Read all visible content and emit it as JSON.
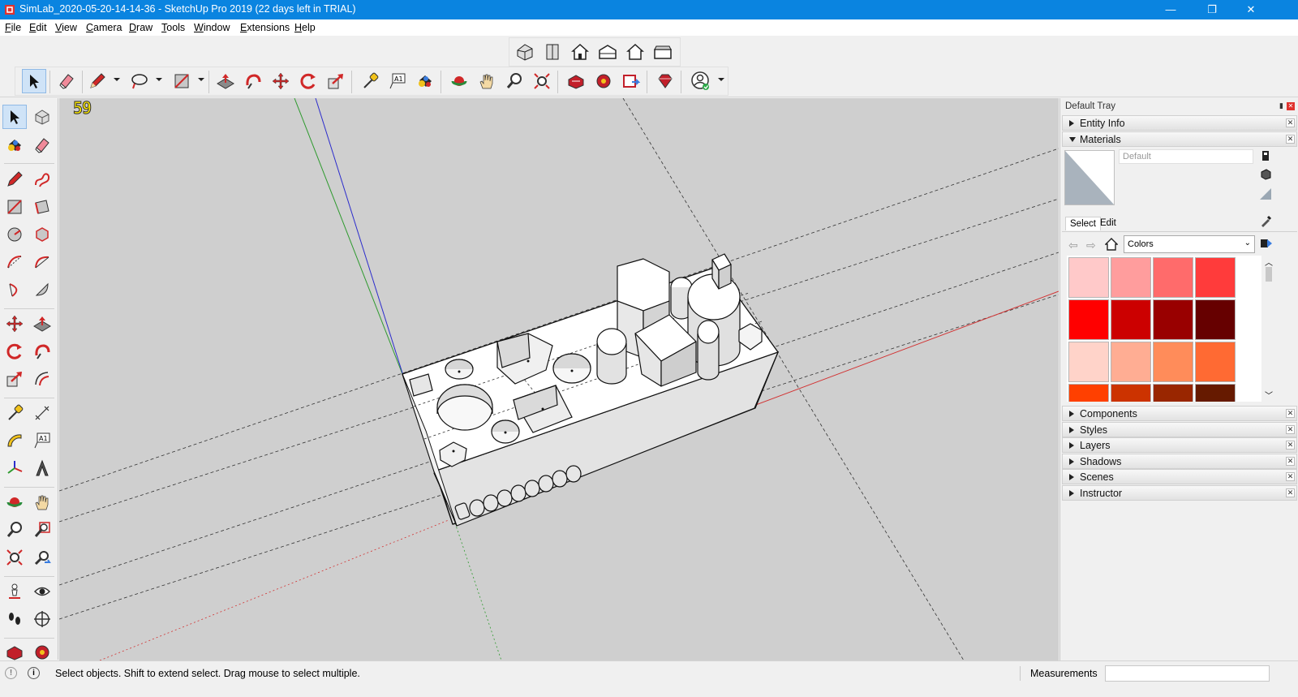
{
  "window": {
    "title": "SimLab_2020-05-20-14-14-36 - SketchUp Pro 2019 (22 days left in TRIAL)",
    "minimize": "—",
    "maximize": "❐",
    "close": "✕"
  },
  "menu": {
    "file": "File",
    "edit": "Edit",
    "view": "View",
    "camera": "Camera",
    "draw": "Draw",
    "tools": "Tools",
    "window": "Window",
    "extensions": "Extensions",
    "help": "Help"
  },
  "viewport": {
    "fps": "59"
  },
  "tray": {
    "title": "Default Tray",
    "panels": {
      "entity_info": "Entity Info",
      "materials": "Materials",
      "components": "Components",
      "styles": "Styles",
      "layers": "Layers",
      "shadows": "Shadows",
      "scenes": "Scenes",
      "instructor": "Instructor"
    },
    "materials": {
      "name_placeholder": "Default",
      "tab_select": "Select",
      "tab_edit": "Edit",
      "library": "Colors",
      "swatches": [
        "#ffc9c9",
        "#ff9d9d",
        "#ff6b6b",
        "#ff3b3b",
        "#ff0000",
        "#cc0000",
        "#990000",
        "#660000",
        "#ffd3c9",
        "#ffad93",
        "#ff8c5a",
        "#ff6a33",
        "#ff4000",
        "#cc3300",
        "#992600",
        "#661a00"
      ]
    }
  },
  "status": {
    "hint": "Select objects. Shift to extend select. Drag mouse to select multiple.",
    "measurements_label": "Measurements",
    "measurements_value": ""
  },
  "colors": {
    "titlebar": "#0a84e0",
    "viewport_bg": "#cfcfcf",
    "axis_red": "#d23232",
    "axis_green": "#2e9a2e",
    "axis_blue": "#2c2ccc"
  }
}
